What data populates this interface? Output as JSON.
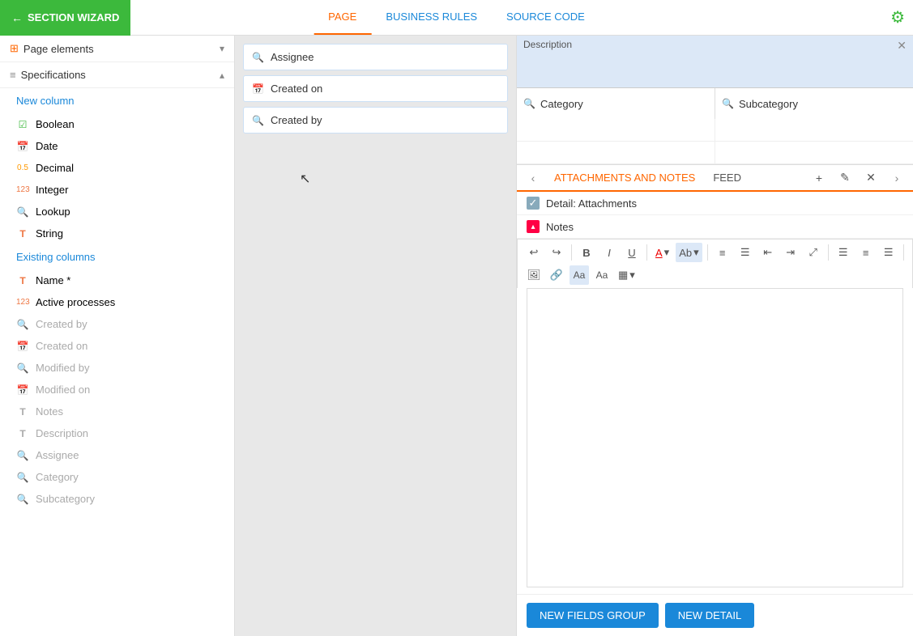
{
  "topNav": {
    "wizardBtn": "SECTION WIZARD",
    "tabs": [
      {
        "label": "PAGE",
        "id": "page",
        "active": true
      },
      {
        "label": "BUSINESS RULES",
        "id": "business-rules",
        "active": false
      },
      {
        "label": "SOURCE CODE",
        "id": "source-code",
        "active": false
      }
    ]
  },
  "sidebar": {
    "pageElements": "Page elements",
    "specifications": "Specifications",
    "newColumn": "New column",
    "newColumnItems": [
      {
        "icon": "☑",
        "iconClass": "icon-check",
        "label": "Boolean"
      },
      {
        "icon": "📅",
        "iconClass": "icon-calendar",
        "label": "Date"
      },
      {
        "icon": "0.5",
        "iconClass": "icon-decimal",
        "label": "Decimal"
      },
      {
        "icon": "123",
        "iconClass": "icon-integer",
        "label": "Integer"
      },
      {
        "icon": "🔍",
        "iconClass": "icon-lookup",
        "label": "Lookup"
      },
      {
        "icon": "T",
        "iconClass": "icon-string",
        "label": "String"
      }
    ],
    "existingColumns": "Existing columns",
    "existingItems": [
      {
        "icon": "T",
        "iconClass": "icon-string2",
        "label": "Name *",
        "muted": false
      },
      {
        "icon": "123",
        "iconClass": "icon-integer2",
        "label": "Active processes",
        "muted": false
      },
      {
        "icon": "🔍",
        "iconClass": "icon-lookup2",
        "label": "Created by",
        "muted": true
      },
      {
        "icon": "📅",
        "iconClass": "icon-calendar2",
        "label": "Created on",
        "muted": true
      },
      {
        "icon": "🔍",
        "iconClass": "icon-lookup2",
        "label": "Modified by",
        "muted": true
      },
      {
        "icon": "📅",
        "iconClass": "icon-calendar2",
        "label": "Modified on",
        "muted": true
      },
      {
        "icon": "T",
        "iconClass": "icon-string2",
        "label": "Notes",
        "muted": true
      },
      {
        "icon": "T",
        "iconClass": "icon-string2",
        "label": "Description",
        "muted": true
      },
      {
        "icon": "🔍",
        "iconClass": "icon-lookup2",
        "label": "Assignee",
        "muted": true
      },
      {
        "icon": "🔍",
        "iconClass": "icon-lookup2",
        "label": "Category",
        "muted": true
      },
      {
        "icon": "🔍",
        "iconClass": "icon-lookup2",
        "label": "Subcategory",
        "muted": true
      }
    ]
  },
  "center": {
    "fields": [
      {
        "icon": "🔍",
        "label": "Assignee"
      },
      {
        "icon": "📅",
        "label": "Created on"
      },
      {
        "icon": "🔍",
        "label": "Created by"
      }
    ]
  },
  "rightPanel": {
    "topGrid": {
      "descLabel": "Description",
      "cells": [
        {
          "icon": "🔍",
          "label": "Category"
        },
        {
          "icon": "🔍",
          "label": "Subcategory"
        }
      ]
    },
    "tabsHeader": {
      "tabs": [
        {
          "label": "ATTACHMENTS AND NOTES",
          "active": true
        },
        {
          "label": "FEED",
          "active": false
        }
      ]
    },
    "details": [
      {
        "label": "Detail: Attachments",
        "checked": true
      },
      {
        "label": "Notes",
        "expanded": true
      }
    ],
    "toolbar": {
      "buttons": [
        "↩",
        "↪",
        "B",
        "I",
        "U",
        "A▾",
        "Ab▾",
        "≡",
        "☰",
        "⇤",
        "⇥",
        "⤢",
        "≡",
        "≡",
        "≡",
        "🖼",
        "🔗",
        "Aa",
        "Aa",
        "▦▾"
      ]
    },
    "footer": {
      "btn1": "NEW FIELDS GROUP",
      "btn2": "NEW DETAIL"
    }
  }
}
